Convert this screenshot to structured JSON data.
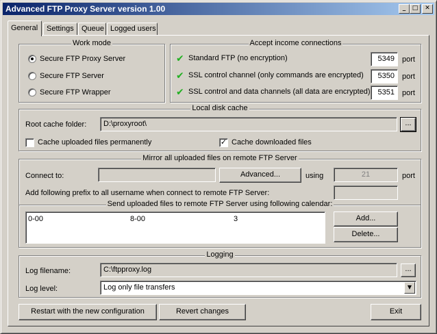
{
  "window": {
    "title": "Advanced FTP Proxy Server version 1.00",
    "minimize_glyph": "_",
    "maximize_glyph": "□",
    "close_glyph": "✕"
  },
  "tabs": [
    {
      "label": "General",
      "active": true
    },
    {
      "label": "Settings",
      "active": false
    },
    {
      "label": "Queue",
      "active": false
    },
    {
      "label": "Logged users",
      "active": false
    }
  ],
  "work_mode": {
    "title": "Work mode",
    "options": [
      {
        "label": "Secure FTP Proxy Server",
        "selected": true
      },
      {
        "label": "Secure FTP Server",
        "selected": false
      },
      {
        "label": "Secure FTP Wrapper",
        "selected": false
      }
    ]
  },
  "accept": {
    "title": "Accept income connections",
    "port_unit": "port",
    "rows": [
      {
        "label": "Standard FTP (no encryption)",
        "port": "5349",
        "enabled": true
      },
      {
        "label": "SSL control channel (only commands are encrypted)",
        "port": "5350",
        "enabled": true
      },
      {
        "label": "SSL control and data channels (all data are encrypted)",
        "port": "5351",
        "enabled": true
      }
    ]
  },
  "cache": {
    "title": "Local disk cache",
    "root_label": "Root cache folder:",
    "root_value": "D:\\proxyroot\\",
    "browse_label": "...",
    "uploaded_label": "Cache uploaded files permanently",
    "uploaded_checked": false,
    "downloaded_label": "Cache downloaded files",
    "downloaded_checked": true
  },
  "mirror": {
    "title": "Mirror all uploaded files on remote FTP Server",
    "connect_label": "Connect to:",
    "connect_value": "",
    "advanced_label": "Advanced...",
    "using_label": "using",
    "port_value": "21",
    "port_unit": "port",
    "prefix_label": "Add following prefix to all username when connect to remote FTP Server:",
    "prefix_value": "",
    "calendar_title": "Send uploaded files to remote FTP Server using following calendar:",
    "calendar_rows": [
      {
        "start": "0-00",
        "end": "8-00",
        "count": "3"
      }
    ],
    "add_label": "Add...",
    "delete_label": "Delete..."
  },
  "logging": {
    "title": "Logging",
    "filename_label": "Log filename:",
    "filename_value": "C:\\ftpproxy.log",
    "browse_label": "...",
    "level_label": "Log level:",
    "level_value": "Log only file transfers"
  },
  "footer": {
    "restart_label": "Restart with the new configuration",
    "revert_label": "Revert changes",
    "exit_label": "Exit"
  },
  "colors": {
    "titlebar_start": "#0a246a",
    "titlebar_end": "#a6caf0",
    "check_green": "#22b022",
    "face": "#d4d0c8"
  }
}
